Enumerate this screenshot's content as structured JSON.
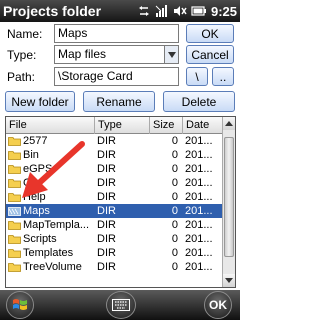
{
  "titlebar": {
    "title": "Projects folder",
    "time": "9:25"
  },
  "form": {
    "name_label": "Name:",
    "name_value": "Maps",
    "ok_label": "OK",
    "type_label": "Type:",
    "type_value": "Map files",
    "cancel_label": "Cancel",
    "path_label": "Path:",
    "path_value": "\\Storage Card",
    "root_button": "\\",
    "up_button": ".."
  },
  "actions": {
    "new_folder": "New folder",
    "rename": "Rename",
    "delete": "Delete"
  },
  "table": {
    "headers": [
      "File",
      "Type",
      "Size",
      "Date"
    ],
    "rows": [
      {
        "name": "2577",
        "type": "DIR",
        "size": "0",
        "date": "201..."
      },
      {
        "name": "Bin",
        "type": "DIR",
        "size": "0",
        "date": "201..."
      },
      {
        "name": "eGPS",
        "type": "DIR",
        "size": "0",
        "date": "201..."
      },
      {
        "name": "Ge",
        "type": "DIR",
        "size": "0",
        "date": "201..."
      },
      {
        "name": "Help",
        "type": "DIR",
        "size": "0",
        "date": "201..."
      },
      {
        "name": "Maps",
        "type": "DIR",
        "size": "0",
        "date": "201...",
        "selected": true
      },
      {
        "name": "MapTempla...",
        "type": "DIR",
        "size": "0",
        "date": "201..."
      },
      {
        "name": "Scripts",
        "type": "DIR",
        "size": "0",
        "date": "201..."
      },
      {
        "name": "Templates",
        "type": "DIR",
        "size": "0",
        "date": "201..."
      },
      {
        "name": "TreeVolume",
        "type": "DIR",
        "size": "0",
        "date": "201..."
      }
    ]
  },
  "bottombar": {
    "ok_label": "OK"
  },
  "icons": {
    "start": "windows-flag-icon",
    "keyboard": "keyboard-icon",
    "folder": "folder-icon",
    "annotation": "red-arrow-annotation"
  },
  "colors": {
    "selection": "#2f5fae",
    "arrow": "#e8352b"
  }
}
